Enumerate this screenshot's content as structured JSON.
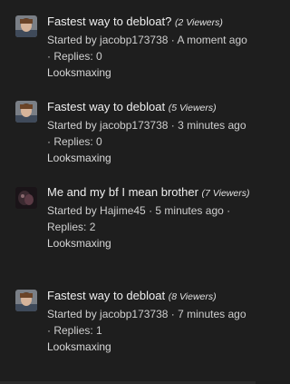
{
  "threads": [
    {
      "title": "Fastest way to debloat?",
      "viewers": "(2 Viewers)",
      "started_by_prefix": "Started by ",
      "author": "jacobp173738",
      "time_sep": " · ",
      "time": "A moment ago",
      "replies_sep": " · ",
      "replies": "Replies: 0",
      "forum": "Looksmaxing",
      "avatar_icon": "user-photo-avatar"
    },
    {
      "title": "Fastest way to debloat",
      "viewers": "(5 Viewers)",
      "started_by_prefix": "Started by ",
      "author": "jacobp173738",
      "time_sep": " · ",
      "time": "3 minutes ago",
      "replies_sep": " · ",
      "replies": "Replies: 0",
      "forum": "Looksmaxing",
      "avatar_icon": "user-photo-avatar"
    },
    {
      "title": "Me and my bf I mean brother",
      "viewers": "(7 Viewers)",
      "started_by_prefix": "Started by ",
      "author": "Hajime45",
      "time_sep": " · ",
      "time": "5 minutes ago",
      "replies_sep": " · ",
      "replies": "Replies: 2",
      "forum": "Looksmaxing",
      "avatar_icon": "user-photo-avatar-dark"
    },
    {
      "title": "Fastest way to debloat",
      "viewers": "(8 Viewers)",
      "started_by_prefix": "Started by ",
      "author": "jacobp173738",
      "time_sep": " · ",
      "time": "7 minutes ago",
      "replies_sep": " · ",
      "replies": "Replies: 1",
      "forum": "Looksmaxing",
      "avatar_icon": "user-photo-avatar"
    }
  ],
  "colors": {
    "background": "#1e1e1e",
    "text": "#efefef",
    "meta_text": "#cfcfcf"
  }
}
